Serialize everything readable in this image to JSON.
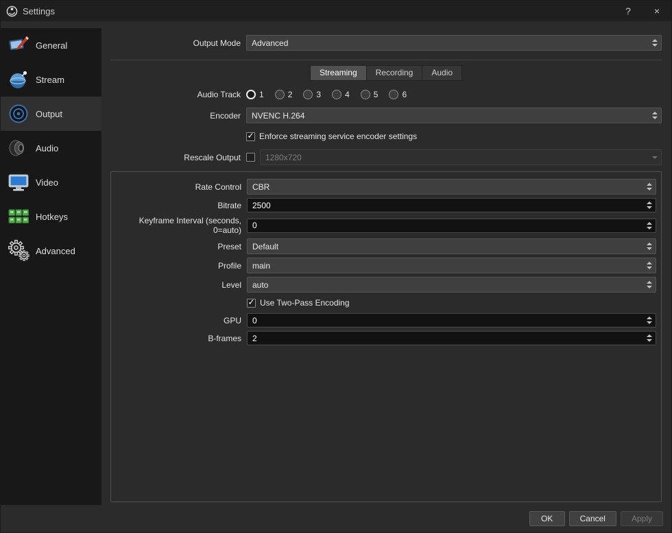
{
  "window": {
    "title": "Settings",
    "help_label": "?",
    "close_label": "×"
  },
  "icons": {
    "checkmark": "✓"
  },
  "sidebar": {
    "items": [
      {
        "label": "General",
        "selected": false
      },
      {
        "label": "Stream",
        "selected": false
      },
      {
        "label": "Output",
        "selected": true
      },
      {
        "label": "Audio",
        "selected": false
      },
      {
        "label": "Video",
        "selected": false
      },
      {
        "label": "Hotkeys",
        "selected": false
      },
      {
        "label": "Advanced",
        "selected": false
      }
    ]
  },
  "output_mode": {
    "label": "Output Mode",
    "value": "Advanced"
  },
  "tabs": {
    "items": [
      {
        "label": "Streaming",
        "active": true
      },
      {
        "label": "Recording",
        "active": false
      },
      {
        "label": "Audio",
        "active": false
      }
    ]
  },
  "streaming": {
    "audio_track": {
      "label": "Audio Track",
      "options": [
        {
          "label": "1",
          "selected": true
        },
        {
          "label": "2",
          "selected": false
        },
        {
          "label": "3",
          "selected": false
        },
        {
          "label": "4",
          "selected": false
        },
        {
          "label": "5",
          "selected": false
        },
        {
          "label": "6",
          "selected": false
        }
      ]
    },
    "encoder": {
      "label": "Encoder",
      "value": "NVENC H.264"
    },
    "enforce_checkbox": {
      "label": "Enforce streaming service encoder settings",
      "checked": true
    },
    "rescale": {
      "label": "Rescale Output",
      "checked": false,
      "value": "1280x720",
      "disabled": true
    },
    "encoder_settings": {
      "rate_control": {
        "label": "Rate Control",
        "value": "CBR"
      },
      "bitrate": {
        "label": "Bitrate",
        "value": "2500"
      },
      "keyframe_interval": {
        "label": "Keyframe Interval (seconds, 0=auto)",
        "value": "0"
      },
      "preset": {
        "label": "Preset",
        "value": "Default"
      },
      "profile": {
        "label": "Profile",
        "value": "main"
      },
      "level": {
        "label": "Level",
        "value": "auto"
      },
      "two_pass_checkbox": {
        "label": "Use Two-Pass Encoding",
        "checked": true
      },
      "gpu": {
        "label": "GPU",
        "value": "0"
      },
      "bframes": {
        "label": "B-frames",
        "value": "2"
      }
    }
  },
  "footer": {
    "ok_label": "OK",
    "cancel_label": "Cancel",
    "apply_label": "Apply",
    "apply_disabled": true
  },
  "colors": {
    "accent": "#2f7bd3",
    "window_bg": "#2b2b2b",
    "sidebar_bg": "#181818"
  }
}
